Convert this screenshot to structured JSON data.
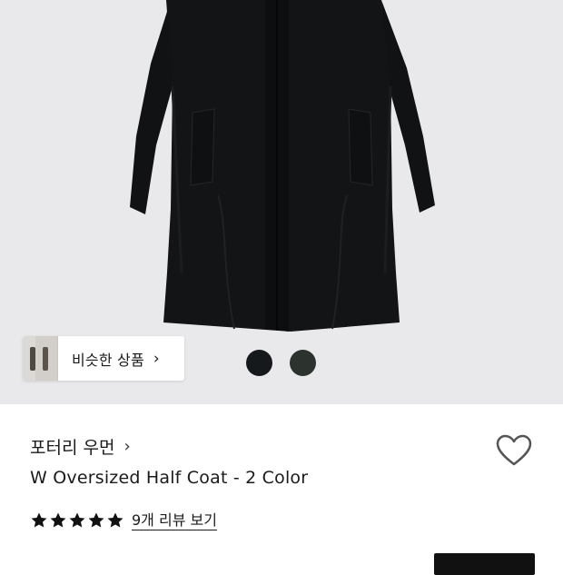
{
  "gallery": {
    "similar_items_label": "비슷한 상품",
    "similar_items_chevron": "›",
    "color_swatches": [
      {
        "name": "black-swatch",
        "color": "#16191c"
      },
      {
        "name": "dark-green-swatch",
        "color": "#2c332f"
      }
    ]
  },
  "product": {
    "brand": "포터리 우먼",
    "brand_chevron": "›",
    "title": "W Oversized Half Coat - 2 Color",
    "rating_stars": 5,
    "review_link": "9개 리뷰 보기"
  },
  "colors": {
    "gallery_bg": "#e9e9eb",
    "coat": "#111214",
    "cta": "#111111"
  }
}
